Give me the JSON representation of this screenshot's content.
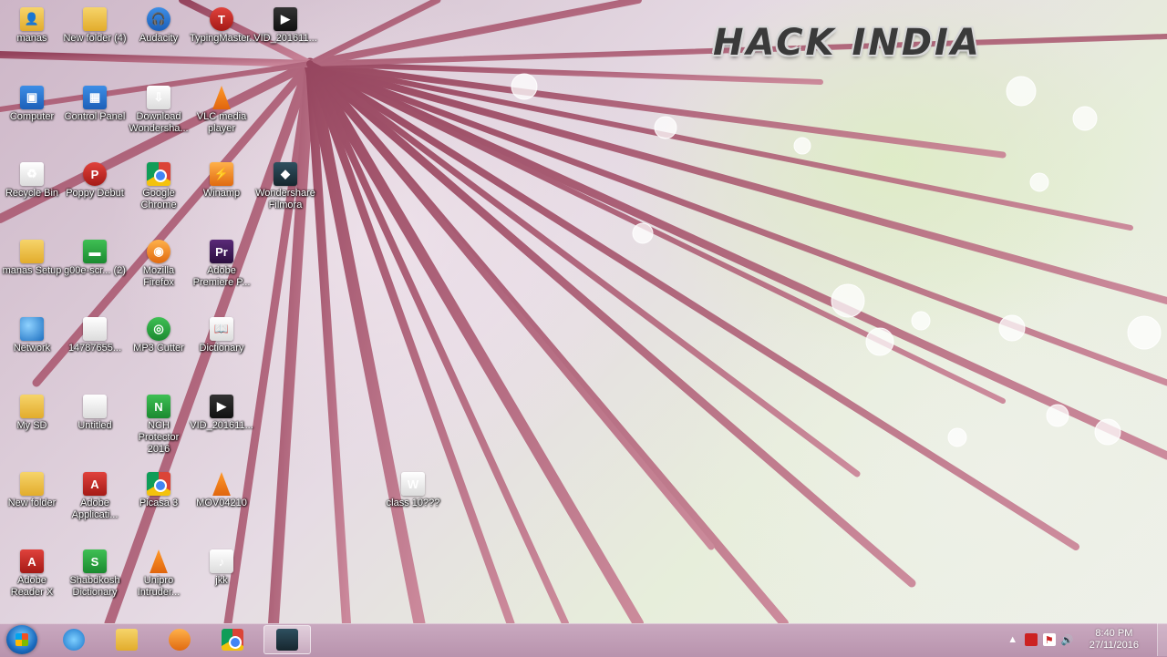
{
  "watermark": "HACK INDIA",
  "desktop_icons": [
    {
      "label": "manas",
      "icon": "user-folder-icon"
    },
    {
      "label": "New folder (4)",
      "icon": "folder-icon"
    },
    {
      "label": "Audacity",
      "icon": "audacity-icon"
    },
    {
      "label": "TypingMaster...",
      "icon": "typingmaster-icon"
    },
    {
      "label": "VID_201611...",
      "icon": "video-file-icon"
    },
    {
      "label": "Computer",
      "icon": "computer-icon"
    },
    {
      "label": "Control Panel",
      "icon": "control-panel-icon"
    },
    {
      "label": "Download Wondersha...",
      "icon": "download-icon"
    },
    {
      "label": "VLC media player",
      "icon": "vlc-icon"
    },
    {
      "label": "Recycle Bin",
      "icon": "recycle-bin-icon"
    },
    {
      "label": "Poppy Debut",
      "icon": "poppy-icon"
    },
    {
      "label": "Google Chrome",
      "icon": "chrome-icon"
    },
    {
      "label": "Winamp",
      "icon": "winamp-icon"
    },
    {
      "label": "Wondershare Filmora",
      "icon": "filmora-icon"
    },
    {
      "label": "manas Setup",
      "icon": "folder-icon"
    },
    {
      "label": "g00e-scr... (2)",
      "icon": "green-window-icon"
    },
    {
      "label": "Mozilla Firefox",
      "icon": "firefox-icon"
    },
    {
      "label": "Adobe Premiere P...",
      "icon": "premiere-icon"
    },
    {
      "label": "Network",
      "icon": "network-icon"
    },
    {
      "label": "14787655...",
      "icon": "file-icon"
    },
    {
      "label": "MP3 Cutter",
      "icon": "mp3-cutter-icon"
    },
    {
      "label": "Dictionary",
      "icon": "dictionary-icon"
    },
    {
      "label": "My SD",
      "icon": "folder-icon"
    },
    {
      "label": "Untitled",
      "icon": "file-icon"
    },
    {
      "label": "NCH Protector 2016",
      "icon": "nch-icon"
    },
    {
      "label": "VID_201611...",
      "icon": "video-file-icon"
    },
    {
      "label": "New folder",
      "icon": "folder-icon"
    },
    {
      "label": "Adobe Applicati...",
      "icon": "adobe-icon"
    },
    {
      "label": "Picasa 3",
      "icon": "picasa-icon"
    },
    {
      "label": "MOV04210",
      "icon": "vlc-icon"
    },
    {
      "label": "class 10???",
      "icon": "word-doc-icon"
    },
    {
      "label": "Adobe Reader X",
      "icon": "adobe-reader-icon"
    },
    {
      "label": "Shabdkosh Dictionary",
      "icon": "shabdkosh-icon"
    },
    {
      "label": "Unipro Intruder...",
      "icon": "vlc-icon"
    },
    {
      "label": "jkk",
      "icon": "audio-file-icon"
    }
  ],
  "taskbar": {
    "start_icon": "windows-start-icon",
    "pinned": [
      {
        "name": "internet-explorer-icon"
      },
      {
        "name": "file-explorer-icon"
      },
      {
        "name": "media-player-icon"
      },
      {
        "name": "chrome-icon"
      },
      {
        "name": "filmora-icon",
        "active": true
      }
    ],
    "clock_time": "8:40 PM",
    "clock_date": "27/11/2016"
  }
}
